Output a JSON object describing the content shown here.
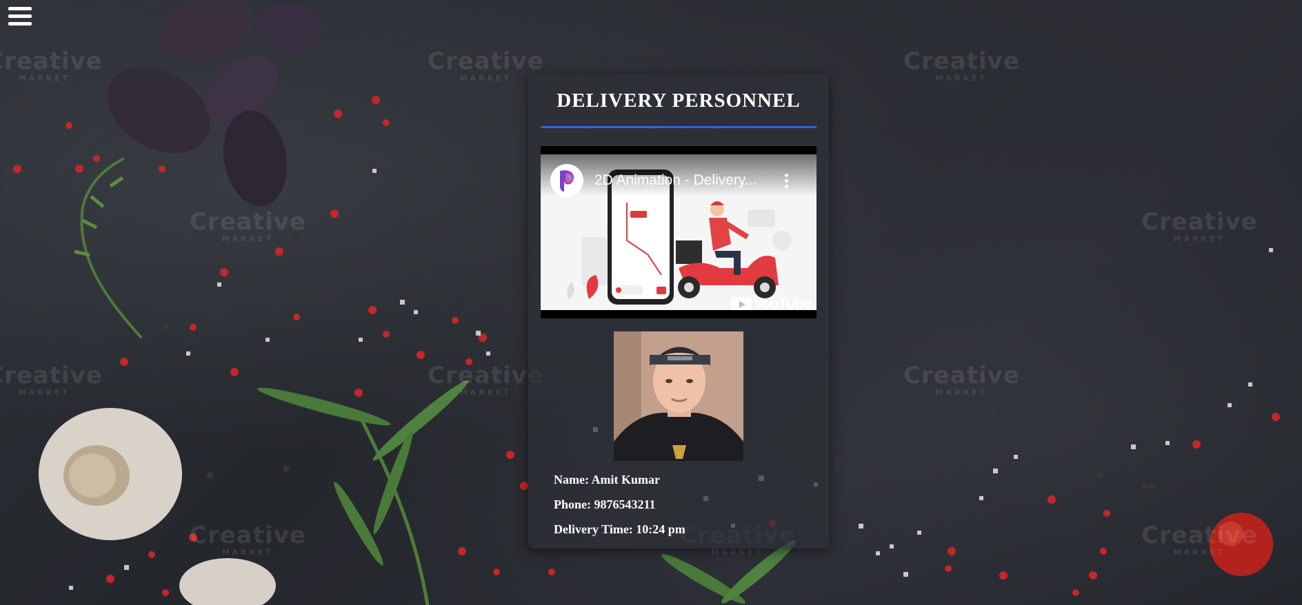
{
  "menu": {
    "icon": "hamburger-menu-icon"
  },
  "card": {
    "title": "DELIVERY PERSONNEL",
    "accent_color": "#2f63e8",
    "video": {
      "title": "2D Animation - Delivery...",
      "platform_label": "YouTube",
      "channel_icon": "channel-logo-icon",
      "more_icon": "more-vertical-icon"
    },
    "photo_alt": "Delivery person photo",
    "info": {
      "name": "Name: Amit Kumar",
      "phone": "Phone: 9876543211",
      "delivery_time": "Delivery Time: 10:24 pm"
    }
  },
  "watermark": {
    "text": "Creative",
    "subtext": "MARKET"
  }
}
